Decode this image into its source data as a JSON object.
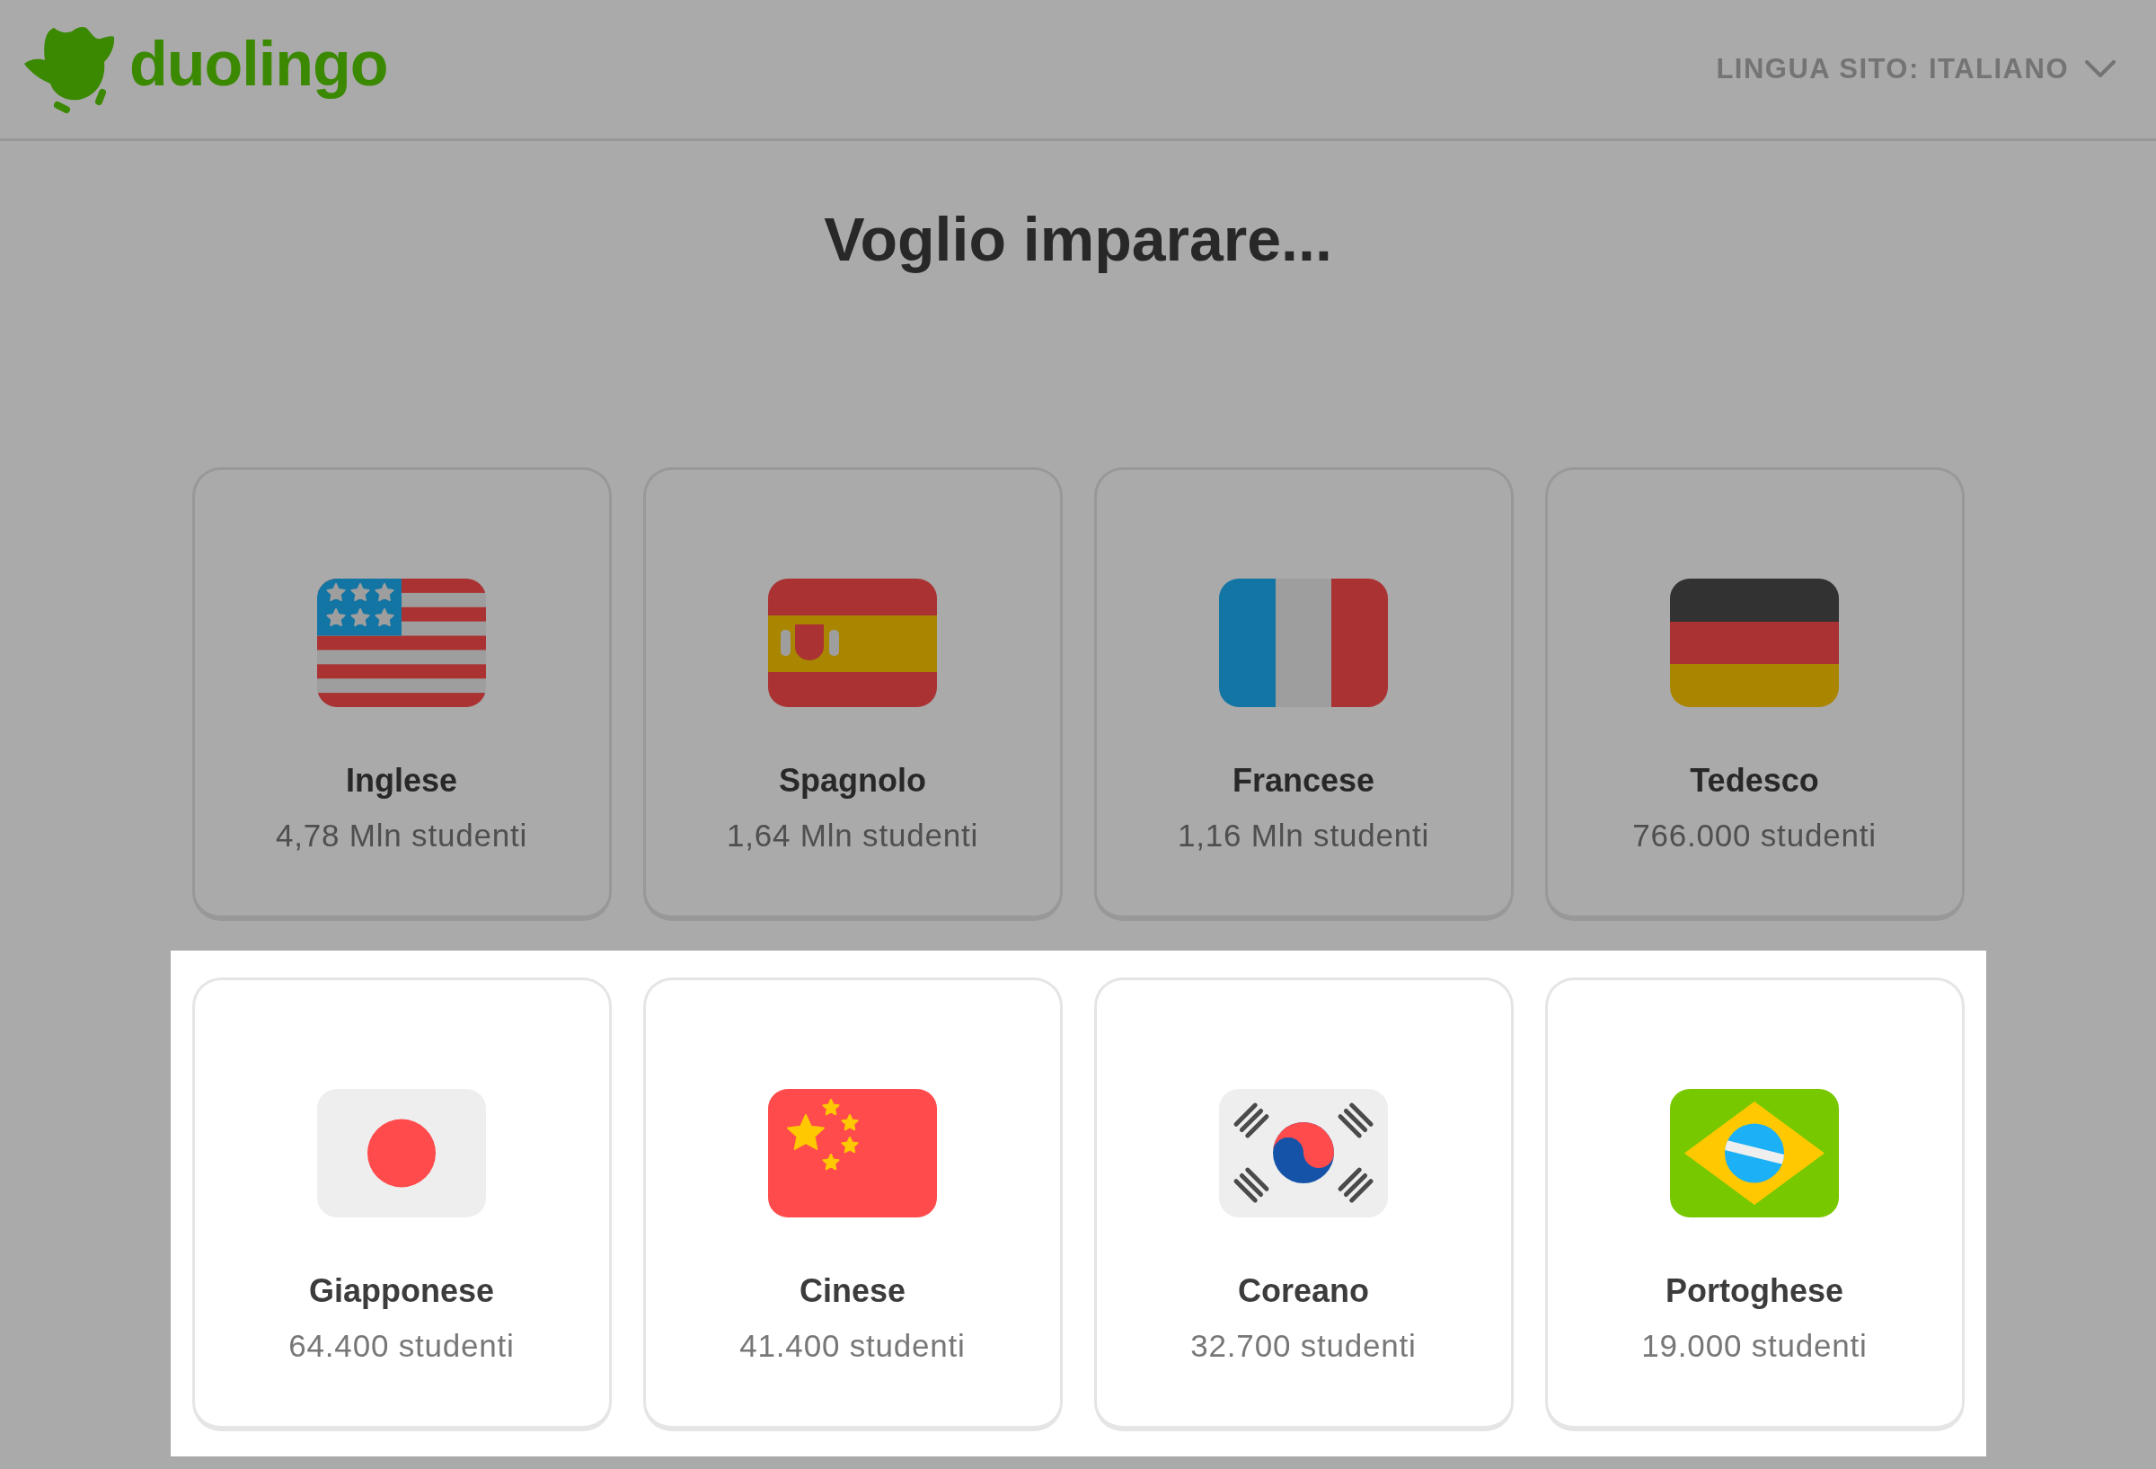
{
  "overlay": true,
  "header": {
    "logo": {
      "text": "duolingo"
    },
    "language_selector": {
      "label": "LINGUA SITO: ITALIANO"
    }
  },
  "heading": "Voglio imparare...",
  "course_rows": [
    {
      "highlighted": false,
      "courses": [
        {
          "name": "Inglese",
          "learners": "4,78 Mln studenti"
        },
        {
          "name": "Spagnolo",
          "learners": "1,64 Mln studenti"
        },
        {
          "name": "Francese",
          "learners": "1,16 Mln studenti"
        },
        {
          "name": "Tedesco",
          "learners": "766.000 studenti"
        }
      ]
    },
    {
      "highlighted": true,
      "courses": [
        {
          "name": "Giapponese",
          "learners": "64.400 studenti"
        },
        {
          "name": "Cinese",
          "learners": "41.400 studenti"
        },
        {
          "name": "Coreano",
          "learners": "32.700 studenti"
        },
        {
          "name": "Portoghese",
          "learners": "19.000 studenti"
        }
      ]
    }
  ]
}
